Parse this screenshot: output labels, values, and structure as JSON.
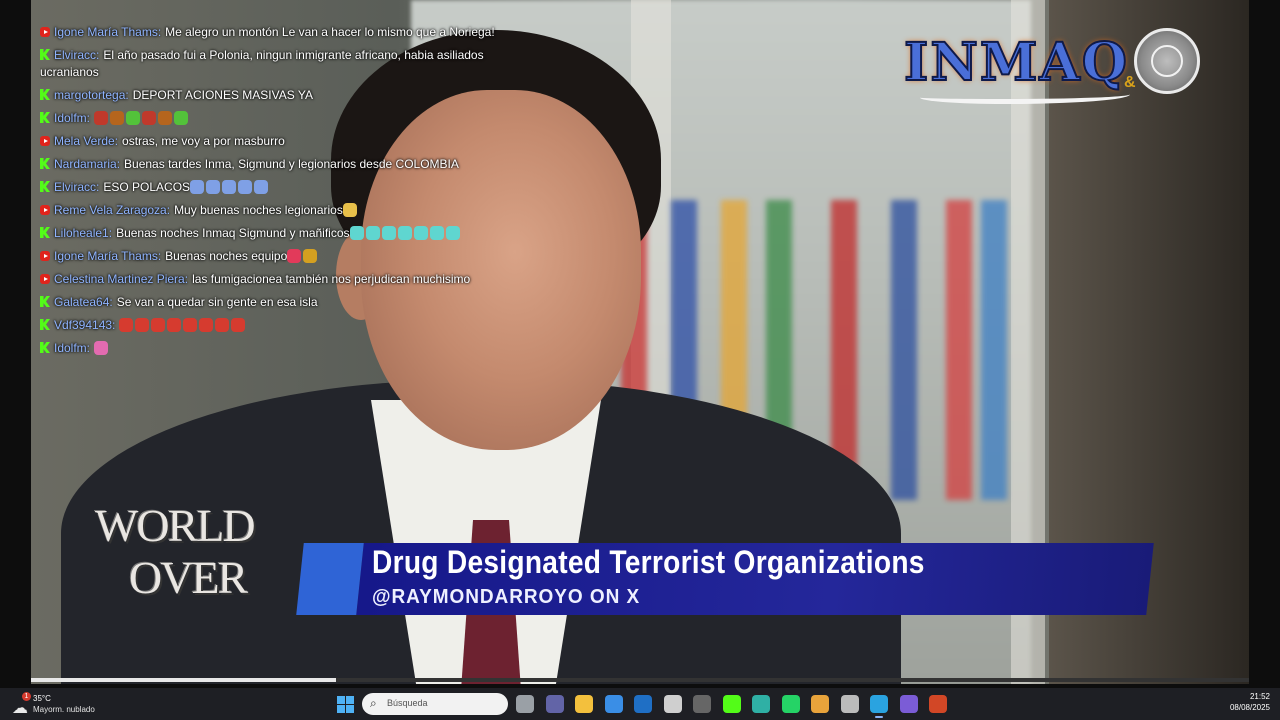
{
  "chat": {
    "messages": [
      {
        "platform": "youtube",
        "author": "Igone María Thams:",
        "text": "Me alegro un montón Le van a hacer lo mismo que a Noriega!"
      },
      {
        "platform": "kick",
        "author": "Elviracc:",
        "text": "El año pasado fui a Polonia, ningun inmigrante africano, habia asiliados ucranianos"
      },
      {
        "platform": "kick",
        "author": "margotortega:",
        "text": "DEPORT ACIONES MASIVAS YA"
      },
      {
        "platform": "kick",
        "author": "Idolfm:",
        "text": ""
      },
      {
        "platform": "youtube",
        "author": "Mela Verde:",
        "text": "ostras, me voy a por masburro"
      },
      {
        "platform": "kick",
        "author": "Nardamaria:",
        "text": "Buenas tardes Inma, Sigmund y legionarios desde COLOMBIA"
      },
      {
        "platform": "kick",
        "author": "Elviracc:",
        "text": "ESO POLACOS"
      },
      {
        "platform": "youtube",
        "author": "Reme Vela Zaragoza:",
        "text": "Muy buenas noches legionarios"
      },
      {
        "platform": "kick",
        "author": "Liloheale1:",
        "text": "Buenas noches Inmaq Sigmund y mañificos"
      },
      {
        "platform": "youtube",
        "author": "Igone María Thams:",
        "text": "Buenas noches equipo"
      },
      {
        "platform": "youtube",
        "author": "Celestina Martinez Piera:",
        "text": "las fumigacionea también nos perjudican muchisimo"
      },
      {
        "platform": "kick",
        "author": "Galatea64:",
        "text": "Se van a quedar sin gente en esa isla"
      },
      {
        "platform": "kick",
        "author": "Vdf394143:",
        "text": ""
      },
      {
        "platform": "kick",
        "author": "Idolfm:",
        "text": ""
      }
    ]
  },
  "video": {
    "show_logo": "WORLD OVER",
    "show_logo_line1": "WORLD",
    "show_logo_line2": "OVER",
    "headline": "Drug Designated Terrorist Organizations",
    "subline": "@RAYMONDARROYO ON X",
    "progress_fraction": 0.25
  },
  "logo": {
    "text": "INMAQ",
    "amp": "&"
  },
  "taskbar": {
    "weather_temp": "35°C",
    "weather_condition": "Mayorm. nublado",
    "weather_badge": "1",
    "search_placeholder": "Búsqueda",
    "time": "21:52",
    "date": "08/08/2025",
    "apps": [
      {
        "name": "task-view-icon",
        "color": "#9aa0a6"
      },
      {
        "name": "teams-icon",
        "color": "#6264a7"
      },
      {
        "name": "file-explorer-icon",
        "color": "#f3c03d"
      },
      {
        "name": "store-icon",
        "color": "#3a8ee6"
      },
      {
        "name": "outlook-icon",
        "color": "#1f6fc5"
      },
      {
        "name": "chatgpt-icon",
        "color": "#cfcfcf"
      },
      {
        "name": "app-icon",
        "color": "#666666"
      },
      {
        "name": "kick-app-icon",
        "color": "#53fc18"
      },
      {
        "name": "edge-icon",
        "color": "#2fb0a5"
      },
      {
        "name": "whatsapp-icon",
        "color": "#25d366"
      },
      {
        "name": "chrome-icon",
        "color": "#e8a33b"
      },
      {
        "name": "window-app-icon",
        "color": "#bbbbbb"
      },
      {
        "name": "telegram-icon",
        "color": "#2aa3e0"
      },
      {
        "name": "circle-app-icon",
        "color": "#7b5cd6"
      },
      {
        "name": "powerpoint-icon",
        "color": "#d24726"
      }
    ]
  }
}
